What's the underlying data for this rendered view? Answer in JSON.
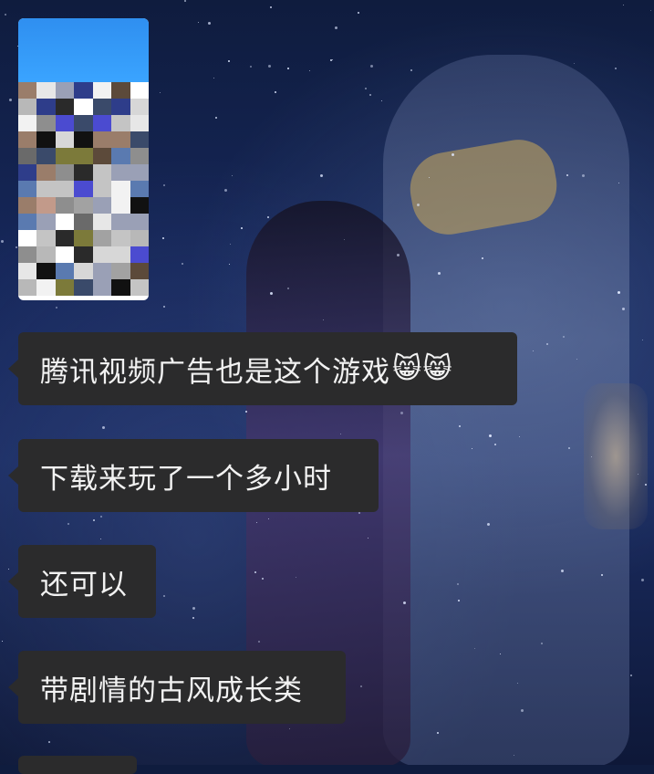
{
  "chat": {
    "messages": [
      {
        "text": "腾讯视频广告也是这个游戏",
        "emoji": "😸😸"
      },
      {
        "text": "下载来玩了一个多小时"
      },
      {
        "text": "还可以"
      },
      {
        "text": "带剧情的古风成长类"
      }
    ]
  },
  "colors": {
    "bubble_bg": "#2b2b2c",
    "bubble_text": "#f2f2f2",
    "wallpaper": "#16275a",
    "thumbnail_header": "#3aa4ff"
  },
  "icons": {
    "emoji": "cat-face-emoji"
  }
}
